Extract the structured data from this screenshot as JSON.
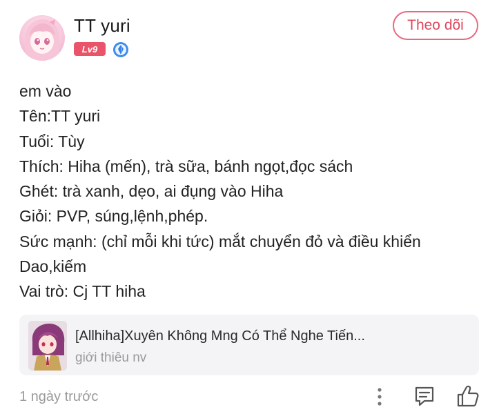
{
  "author": {
    "name": "TT yuri",
    "level": "Lv9",
    "avatar_icon": "anime-girl-avatar",
    "verified_icon": "blue-diamond-badge-icon"
  },
  "follow_button": {
    "label": "Theo dõi"
  },
  "post": {
    "lines": [
      "em vào",
      "Tên:TT yuri",
      "Tuổi: Tùy",
      "Thích: Hiha (mến), trà sữa, bánh ngọt,đọc sách",
      "Ghét: trà xanh, dẹo, ai đụng vào Hiha",
      "Giỏi: PVP, súng,lệnh,phép.",
      "Sức mạnh: (chỉ mỗi khi tức) mắt chuyển đỏ và điều khiển",
      "Dao,kiếm",
      "Vai trò: Cj TT hiha"
    ]
  },
  "link_card": {
    "title": "[Allhiha]Xuyên Không Mng Có Thể Nghe Tiến...",
    "subtitle": "giới thiêu nv",
    "thumb_icon": "anime-boy-cover"
  },
  "footer": {
    "timestamp": "1 ngày trước",
    "more_icon": "more-vertical-icon",
    "comment_icon": "comment-icon",
    "like_icon": "thumbs-up-icon"
  },
  "colors": {
    "accent": "#e2455c",
    "level_badge": "#e9546a",
    "card_bg": "#f4f4f6",
    "muted_text": "#9a9a9a"
  }
}
